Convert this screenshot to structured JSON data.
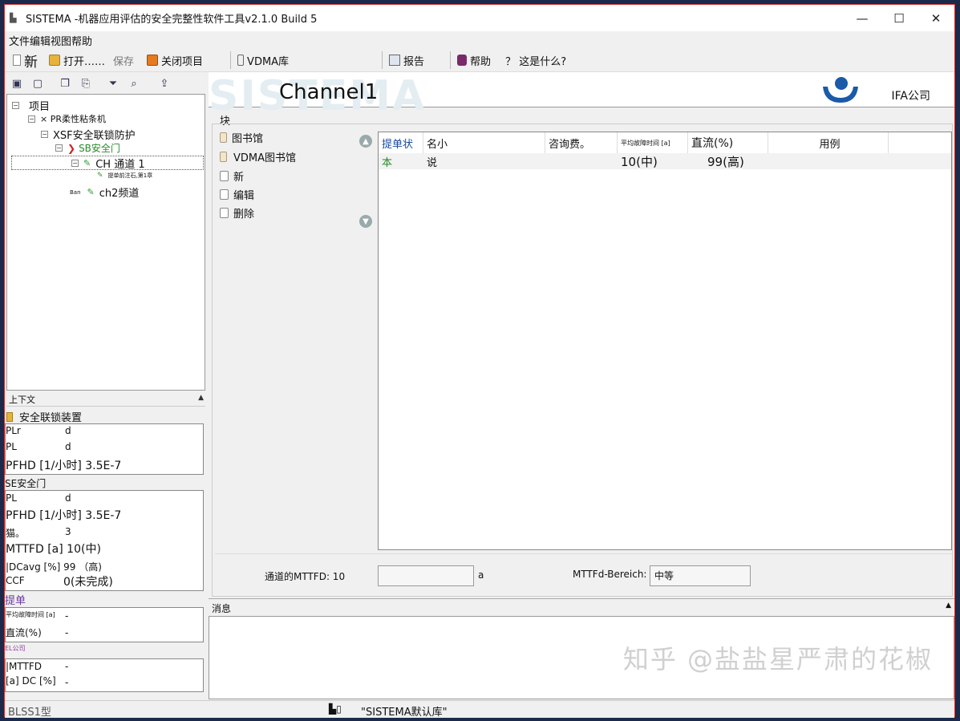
{
  "window": {
    "title": "SISTEMA -机器应用评估的安全完整性软件工具v2.1.0 Build 5"
  },
  "menubar": {
    "label": "文件编辑视图帮助"
  },
  "toolbar": {
    "new": "新",
    "open": "打开……",
    "save": "保存",
    "close_project": "关闭项目",
    "vdma": "VDMA库",
    "report": "报告",
    "help": "帮助",
    "whats_this": "？ 这是什么?"
  },
  "tree": {
    "root": "项目",
    "pr": "× PR柔性粘条机",
    "xsf": "XSF安全联锁防护",
    "sb": "SB安全门",
    "ch1": "CH 通道 1",
    "sub": "提单前注石,第1章",
    "ch2_prefix": "Ban",
    "ch2": "ch2频道"
  },
  "context": {
    "header": "上下文",
    "device_title": "安全联锁装置",
    "plr_label": "PLr",
    "plr_value": "d",
    "pl_label": "PL",
    "pl_value": "d",
    "pfhd": "PFHD [1/小时] 3.5E-7",
    "se_title": "SE安全门",
    "se_pl_label": "PL",
    "se_pl_value": "d",
    "se_pfhd": "PFHD [1/小时] 3.5E-7",
    "cat_label": "猫。",
    "cat_value": "3",
    "mttfd": "MTTFD [a] 10(中)",
    "dcavg": "|DCavg [%] 99 （高)",
    "ccf_label": "CCF",
    "ccf_value": "0(未完成)",
    "tidan": "提单",
    "mttf_small": "平均故障时间 [a]",
    "mttf_small_value": "-",
    "dc_label": "直流(%)",
    "dc_value": "-",
    "el_title": "EL公司",
    "el_mttfd": "|MTTFD",
    "el_mttfd_value": "-",
    "el_dc": "[a] DC [%]",
    "el_dc_value": "-"
  },
  "main": {
    "bg_watermark": "SISTEMA",
    "channel_title": "Channel1",
    "company": "IFA公司",
    "block_label": "块",
    "library": [
      "图书馆",
      "VDMA图书馆"
    ],
    "actions": [
      "新",
      "编辑",
      "删除"
    ],
    "columns": [
      "提单状",
      "名小",
      "咨询费。",
      "平均故障时间 [a]",
      "直流(%)",
      "用例"
    ],
    "rows": [
      {
        "status": "本",
        "name": "说",
        "fee": "",
        "mttf": "10(中)",
        "dc": "99(高)",
        "usage": ""
      }
    ],
    "mttfd_label": "通道的MTTFD: 10",
    "mttfd_unit": "a",
    "mttfd_range_label": "MTTFd-Bereich:",
    "mttfd_range_value": "中等"
  },
  "messages": {
    "header": "消息",
    "watermark": "知乎 @盐盐星严肃的花椒"
  },
  "statusbar": {
    "left": "BLSS1型",
    "library": "\"SISTEMA默认库\""
  }
}
